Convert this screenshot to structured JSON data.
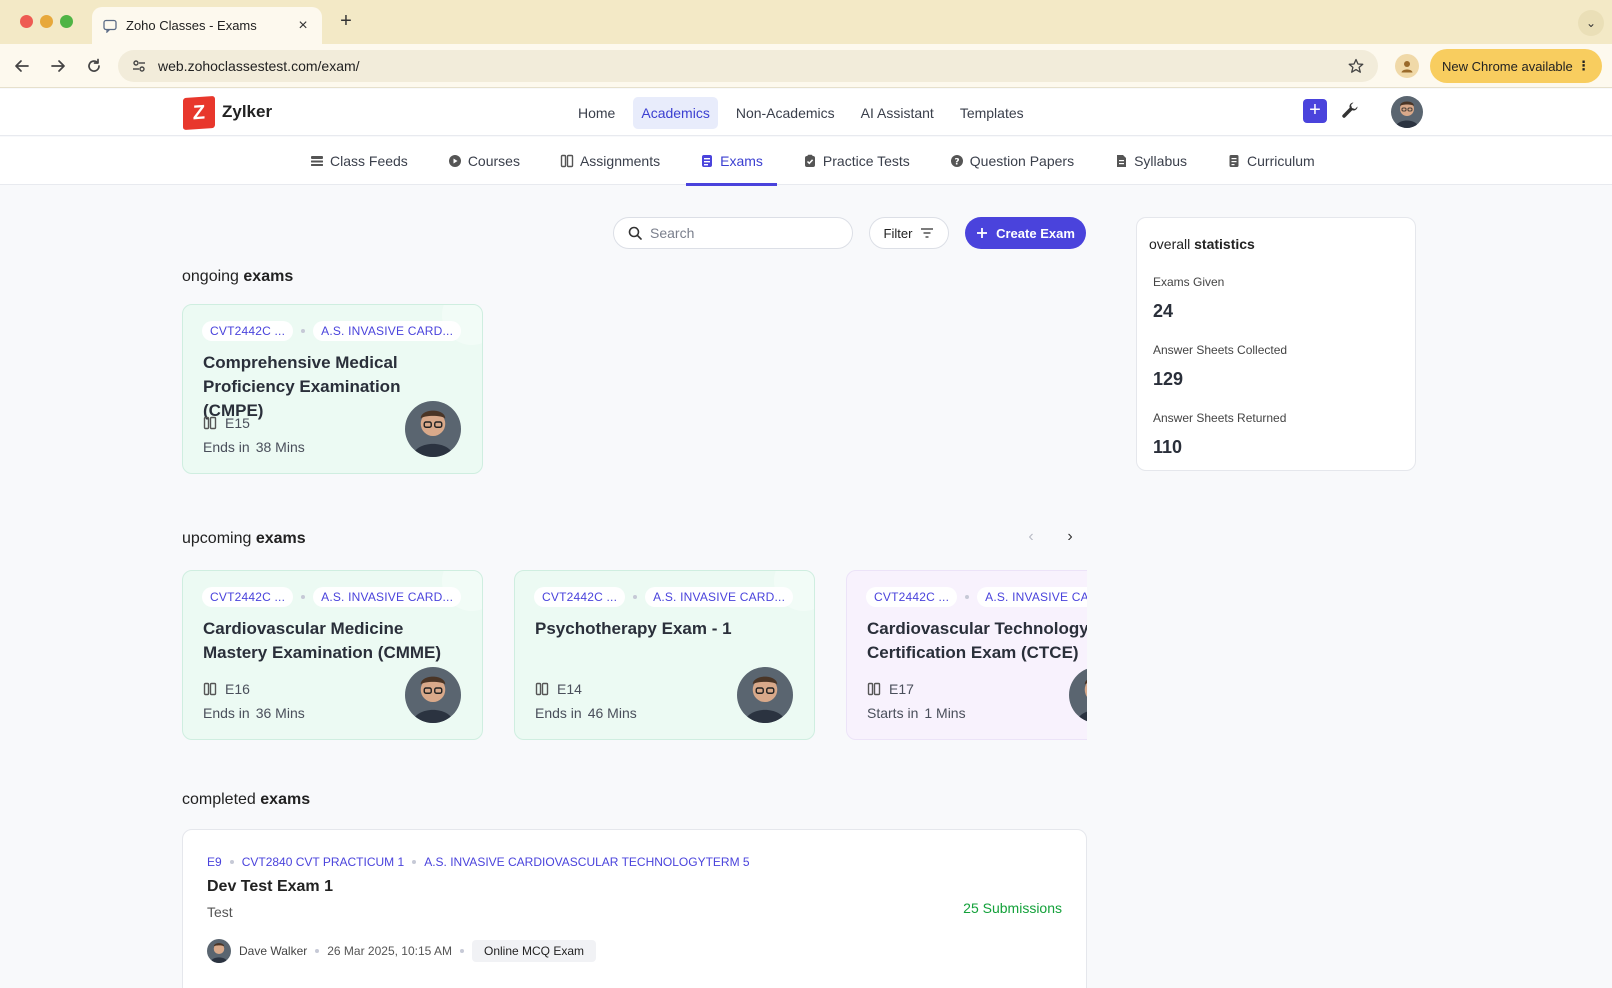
{
  "browser": {
    "tab_title": "Zoho Classes - Exams",
    "url": "web.zohoclassestest.com/exam/",
    "update_label": "New Chrome available"
  },
  "app": {
    "brand": "Zylker",
    "logo_letter": "Z",
    "top_nav": [
      "Home",
      "Academics",
      "Non-Academics",
      "AI Assistant",
      "Templates"
    ],
    "active_top_nav": "Academics",
    "sub_nav": [
      "Class Feeds",
      "Courses",
      "Assignments",
      "Exams",
      "Practice Tests",
      "Question Papers",
      "Syllabus",
      "Curriculum"
    ],
    "active_sub_nav": "Exams"
  },
  "toolbar": {
    "search_placeholder": "Search",
    "filter_label": "Filter",
    "create_label": "Create Exam"
  },
  "sections": {
    "ongoing": {
      "prefix": "ongoing",
      "strong": "exams"
    },
    "upcoming": {
      "prefix": "upcoming",
      "strong": "exams"
    },
    "completed": {
      "prefix": "completed",
      "strong": "exams"
    }
  },
  "ongoing_exams": [
    {
      "chip1": "CVT2442C ...",
      "chip2": "A.S. INVASIVE CARD...",
      "title": "Comprehensive Medical Proficiency Examination (CMPE)",
      "code": "E15",
      "time_label": "Ends in",
      "time_value": "38 Mins"
    }
  ],
  "upcoming_exams": [
    {
      "chip1": "CVT2442C ...",
      "chip2": "A.S. INVASIVE CARD...",
      "title": "Cardiovascular Medicine Mastery Examination (CMME)",
      "code": "E16",
      "time_label": "Ends in",
      "time_value": "36 Mins"
    },
    {
      "chip1": "CVT2442C ...",
      "chip2": "A.S. INVASIVE CARD...",
      "title": "Psychotherapy Exam - 1",
      "code": "E14",
      "time_label": "Ends in",
      "time_value": "46 Mins"
    },
    {
      "chip1": "CVT2442C ...",
      "chip2": "A.S. INVASIVE CA",
      "title": "Cardiovascular Technology Certification Exam (CTCE)",
      "code": "E17",
      "time_label": "Starts in",
      "time_value": "1 Mins"
    }
  ],
  "completed_exams": [
    {
      "code": "E9",
      "course": "CVT2840 CVT PRACTICUM 1",
      "program": "A.S. INVASIVE CARDIOVASCULAR TECHNOLOGYTERM 5",
      "title": "Dev Test Exam 1",
      "subtitle": "Test",
      "submissions": "25 Submissions",
      "author": "Dave Walker",
      "date": "26 Mar 2025, 10:15 AM",
      "exam_type": "Online MCQ Exam"
    }
  ],
  "stats": {
    "title_prefix": "overall",
    "title_strong": "statistics",
    "items": [
      {
        "label": "Exams Given",
        "value": "24"
      },
      {
        "label": "Answer Sheets Collected",
        "value": "129"
      },
      {
        "label": "Answer Sheets Returned",
        "value": "110"
      }
    ]
  },
  "colors": {
    "accent": "#4a43dc",
    "card_green": "#ecfaf3",
    "card_purple": "#f8f2fd",
    "success": "#13a13a"
  }
}
